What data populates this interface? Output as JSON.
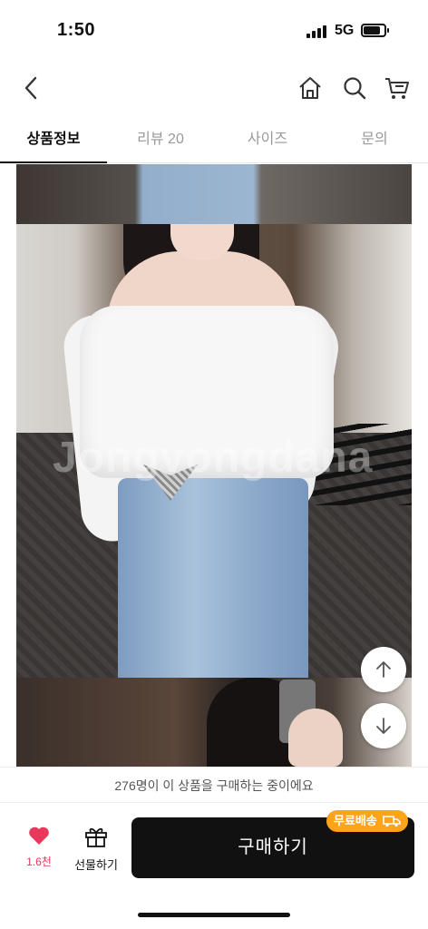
{
  "status_bar": {
    "time": "1:50",
    "network": "5G"
  },
  "nav": {
    "back_icon": "chevron-left-icon",
    "home_icon": "home-icon",
    "search_icon": "search-icon",
    "cart_icon": "cart-icon"
  },
  "tabs": [
    {
      "label": "상품정보",
      "active": true
    },
    {
      "label": "리뷰 20",
      "active": false
    },
    {
      "label": "사이즈",
      "active": false
    },
    {
      "label": "문의",
      "active": false
    }
  ],
  "content": {
    "watermark": "Jongvongdana"
  },
  "scroll_buttons": {
    "up_icon": "arrow-up-icon",
    "down_icon": "arrow-down-icon"
  },
  "notice": "276명이 이 상품을 구매하는 중이에요",
  "actions": {
    "like_count": "1.6천",
    "gift_label": "선물하기",
    "buy_label": "구매하기",
    "free_shipping_badge": "무료배송"
  },
  "colors": {
    "accent_heart": "#e8385b",
    "badge": "#ffa31a",
    "buy_button": "#111111"
  }
}
